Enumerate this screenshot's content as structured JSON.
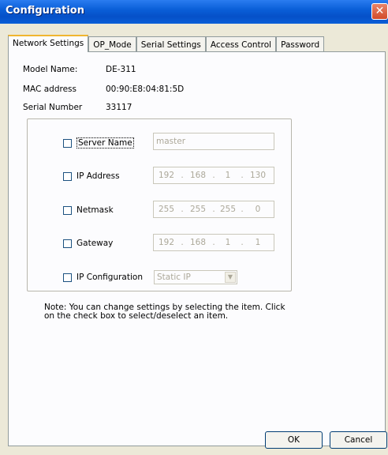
{
  "window": {
    "title": "Configuration",
    "close_glyph": "✕"
  },
  "tabs": [
    "Network Settings",
    "OP_Mode",
    "Serial Settings",
    "Access Control",
    "Password"
  ],
  "active_tab": "Network Settings",
  "info": {
    "model_label": "Model Name:",
    "model_value": "DE-311",
    "mac_label": "MAC address",
    "mac_value": "00:90:E8:04:81:5D",
    "serial_label": "Serial Number",
    "serial_value": "33117"
  },
  "fields": {
    "server_name": {
      "label": "Server Name",
      "value": "master"
    },
    "ip_address": {
      "label": "IP Address",
      "octets": [
        "192",
        "168",
        "1",
        "130"
      ]
    },
    "netmask": {
      "label": "Netmask",
      "octets": [
        "255",
        "255",
        "255",
        "0"
      ]
    },
    "gateway": {
      "label": "Gateway",
      "octets": [
        "192",
        "168",
        "1",
        "1"
      ]
    },
    "ip_configuration": {
      "label": "IP Configuration",
      "value": "Static IP"
    }
  },
  "ip_separator": ".",
  "note": "Note: You can change settings by selecting the item. Click on the check box to select/deselect an item.",
  "buttons": {
    "ok": "OK",
    "cancel": "Cancel"
  },
  "icons": {
    "dropdown": "chevron-down-icon",
    "close": "close-icon"
  }
}
